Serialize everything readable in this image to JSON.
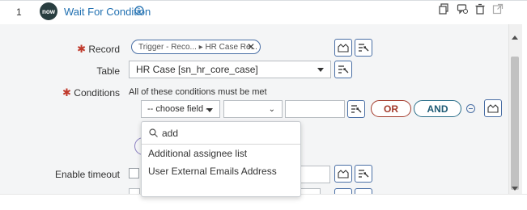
{
  "step": {
    "number": "1",
    "logo_text": "now",
    "title": "Wait For Condition"
  },
  "record": {
    "required_mark": "✱",
    "label": "Record",
    "pill_text": "Trigger - Reco... ▸ HR Case Re...",
    "remove_glyph": "✕"
  },
  "table": {
    "label": "Table",
    "value": "HR Case [sn_hr_core_case]"
  },
  "conditions": {
    "required_mark": "✱",
    "label": "Conditions",
    "description": "All of these conditions must be met",
    "field_select": "-- choose field --",
    "or_label": "OR",
    "and_label": "AND"
  },
  "field_dropdown": {
    "search_value": "add",
    "options": [
      "Additional assignee list",
      "User External Emails Address"
    ]
  },
  "timeout": {
    "label": "Enable timeout"
  },
  "icons": {
    "info": "info-icon",
    "copy": "copy-icon",
    "comment": "comment-icon",
    "delete": "trash-icon",
    "open": "open-external-icon",
    "data_pill_picker": "data-pill-picker-icon",
    "script": "script-toggle-icon",
    "search": "search-icon"
  },
  "colors": {
    "link_blue": "#1f6fb0",
    "or_red": "#a33a2b",
    "and_teal": "#1f5b75",
    "required_red": "#c0392b"
  }
}
